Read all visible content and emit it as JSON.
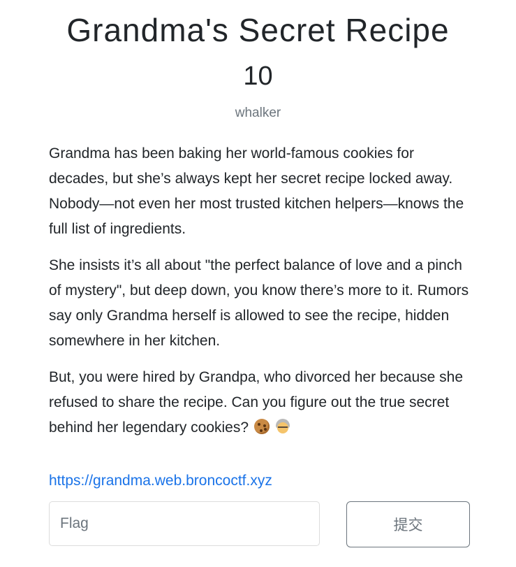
{
  "challenge": {
    "title": "Grandma's Secret Recipe",
    "points": "10",
    "author": "whalker",
    "description": {
      "paragraph_1": "Grandma has been baking her world-famous cookies for decades, but she’s always kept her secret recipe locked away. Nobody—not even her most trusted kitchen helpers—knows the full list of ingredients.",
      "paragraph_2": "She insists it’s all about \"the perfect balance of love and a pinch of mystery\", but deep down, you know there’s more to it. Rumors say only Grandma herself is allowed to see the recipe, hidden somewhere in her kitchen.",
      "paragraph_3": "But, you were hired by Grandpa, who divorced her because she refused to share the recipe. Can you figure out the true secret behind her legendary cookies?",
      "icons": [
        "cookie-icon",
        "older-woman-icon"
      ]
    },
    "link": {
      "text": "https://grandma.web.broncoctf.xyz"
    },
    "flag_input": {
      "placeholder": "Flag",
      "value": ""
    },
    "submit_button": {
      "label": "提交"
    }
  },
  "colors": {
    "text": "#212529",
    "muted": "#6c757d",
    "link": "#1a73e8"
  }
}
